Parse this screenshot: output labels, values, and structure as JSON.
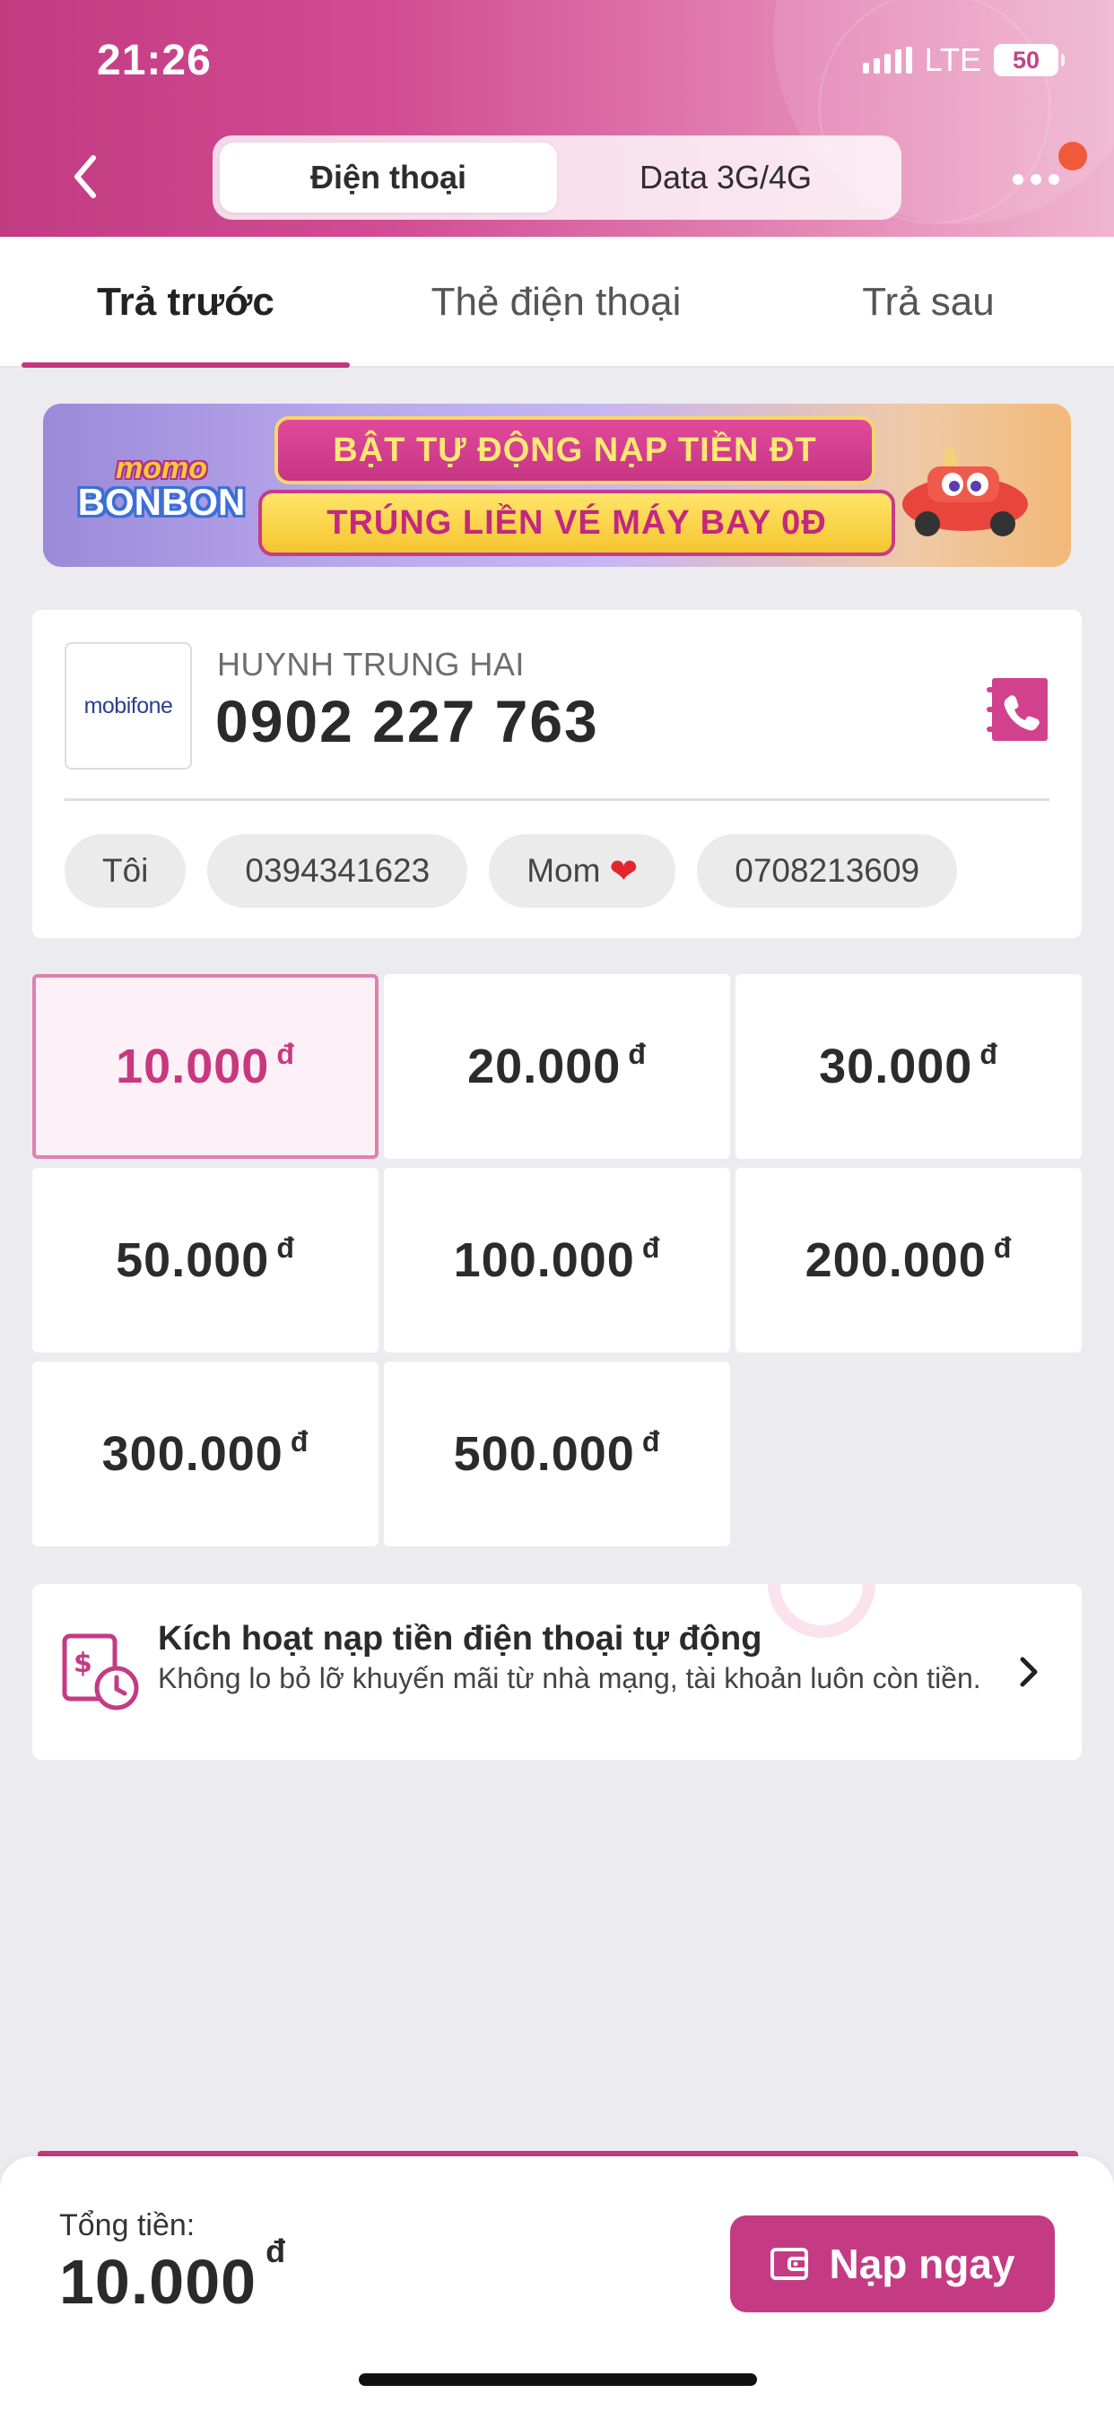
{
  "status_bar": {
    "time": "21:26",
    "network": "LTE",
    "battery": "50"
  },
  "header": {
    "segments": [
      {
        "label": "Điện thoại",
        "active": true
      },
      {
        "label": "Data 3G/4G",
        "active": false
      }
    ],
    "icons": {
      "back": "chevron-left-icon",
      "more": "more-horizontal-icon"
    }
  },
  "tabs": [
    {
      "label": "Trả trước",
      "active": true
    },
    {
      "label": "Thẻ điện thoại",
      "active": false
    },
    {
      "label": "Trả sau",
      "active": false
    }
  ],
  "banner": {
    "logo_top": "momo",
    "logo_bottom": "BONBON",
    "line1": "BẬT TỰ ĐỘNG NẠP TIỀN ĐT",
    "line2": "TRÚNG LIỀN VÉ MÁY BAY 0Đ"
  },
  "phone": {
    "carrier": "mobifone",
    "owner_name": "HUYNH TRUNG HAI",
    "number": "0902 227 763",
    "contacts": [
      "Tôi",
      "0394341623",
      "Mom",
      "0708213609"
    ]
  },
  "amounts": [
    {
      "value": "10.000",
      "currency": "đ",
      "selected": true
    },
    {
      "value": "20.000",
      "currency": "đ",
      "selected": false
    },
    {
      "value": "30.000",
      "currency": "đ",
      "selected": false
    },
    {
      "value": "50.000",
      "currency": "đ",
      "selected": false
    },
    {
      "value": "100.000",
      "currency": "đ",
      "selected": false
    },
    {
      "value": "200.000",
      "currency": "đ",
      "selected": false
    },
    {
      "value": "300.000",
      "currency": "đ",
      "selected": false
    },
    {
      "value": "500.000",
      "currency": "đ",
      "selected": false
    }
  ],
  "auto_topup": {
    "title": "Kích hoạt nạp tiền điện thoại tự động",
    "description": "Không lo bỏ lỡ khuyến mãi từ nhà mạng, tài khoản luôn còn tiền."
  },
  "footer": {
    "total_label": "Tổng tiền:",
    "total_value": "10.000",
    "currency": "đ",
    "button_label": "Nạp ngay"
  },
  "colors": {
    "brand": "#c43b84",
    "selected_bg": "#fdf0f6",
    "background": "#ececf0"
  }
}
